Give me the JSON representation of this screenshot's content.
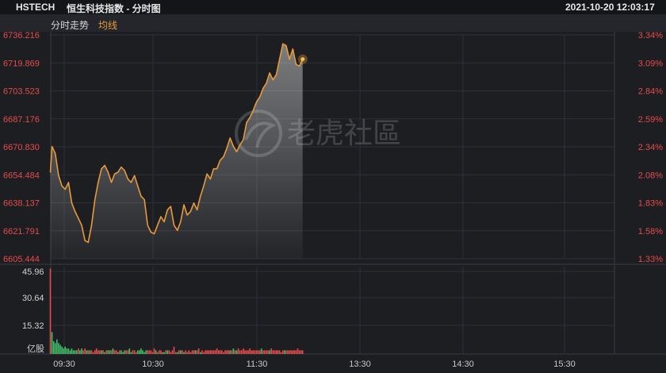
{
  "header": {
    "symbol": "HSTECH",
    "name": "恒生科技指数 - 分时图",
    "datetime": "2021-10-20 12:03:17"
  },
  "tabs": [
    {
      "label": "分时走势",
      "color": "#d8d8d8"
    },
    {
      "label": "均线",
      "color": "#e69a3c"
    }
  ],
  "watermark": "老虎社區",
  "colors": {
    "price_line": "#e69a3c",
    "up": "#e64b4b",
    "down": "#3fbf6a",
    "grid": "#2e3036"
  },
  "chart_data": [
    {
      "type": "line",
      "title": "",
      "xlabel": "",
      "ylabel": "",
      "x_ticks": [
        "09:30",
        "10:30",
        "11:30",
        "13:30",
        "14:30",
        "15:30"
      ],
      "y_ticks_left": [
        "6736.216",
        "6719.869",
        "6703.523",
        "6687.176",
        "6670.830",
        "6654.484",
        "6638.137",
        "6621.791",
        "6605.444"
      ],
      "y_ticks_right": [
        "3.34%",
        "3.09%",
        "2.84%",
        "2.59%",
        "2.34%",
        "2.08%",
        "1.83%",
        "1.58%",
        "1.33%"
      ],
      "ylim": [
        6605.444,
        6736.216
      ],
      "grid": true,
      "series": [
        {
          "x": [
            0,
            1,
            3,
            5,
            7,
            9,
            11,
            13,
            15,
            17,
            19,
            21,
            23,
            25,
            27,
            29,
            31,
            33,
            35,
            37,
            39,
            41,
            43,
            45,
            47,
            49,
            51,
            53,
            55,
            57,
            59,
            61,
            63,
            65,
            67,
            69,
            71,
            73,
            75,
            77,
            79,
            81,
            83,
            85,
            87,
            89,
            91,
            93,
            95,
            97,
            99,
            101,
            103,
            105,
            107,
            109,
            111,
            113,
            115,
            117,
            119,
            121,
            123,
            125,
            127,
            129,
            131,
            133,
            135,
            137,
            139,
            141,
            143,
            145,
            147,
            149,
            151,
            153
          ],
          "values": [
            6656,
            6671,
            6667,
            6654,
            6648,
            6646,
            6650,
            6638,
            6633,
            6629,
            6625,
            6616,
            6615,
            6625,
            6640,
            6650,
            6658,
            6660,
            6656,
            6650,
            6655,
            6656,
            6659,
            6657,
            6652,
            6650,
            6654,
            6648,
            6642,
            6640,
            6625,
            6621,
            6620,
            6625,
            6630,
            6627,
            6634,
            6636,
            6625,
            6622,
            6627,
            6637,
            6631,
            6633,
            6638,
            6634,
            6642,
            6648,
            6655,
            6652,
            6658,
            6658,
            6663,
            6665,
            6670,
            6676,
            6671,
            6668,
            6672,
            6675,
            6685,
            6688,
            6692,
            6697,
            6700,
            6705,
            6708,
            6714,
            6710,
            6713,
            6722,
            6731,
            6730,
            6722,
            6728,
            6719,
            6718,
            6722
          ]
        }
      ]
    },
    {
      "type": "bar",
      "title": "",
      "ylabel": "亿股",
      "y_ticks": [
        "45.96",
        "30.64",
        "15.32"
      ],
      "ylim": [
        0,
        48
      ],
      "grid": true,
      "x": [
        0,
        1,
        2,
        3,
        4,
        5,
        6,
        7,
        8,
        9,
        10,
        11,
        12,
        13,
        14,
        15,
        16,
        17,
        18,
        19,
        20,
        21,
        22,
        23,
        24,
        25,
        26,
        27,
        28,
        29,
        30,
        31,
        32,
        33,
        34,
        35,
        36,
        37,
        38,
        39,
        40,
        41,
        42,
        43,
        44,
        45,
        46,
        47,
        48,
        49,
        50,
        51,
        52,
        53,
        54,
        55,
        56,
        57,
        58,
        59,
        60,
        61,
        62,
        63,
        64,
        65,
        66,
        67,
        68,
        69,
        70,
        71,
        72,
        73,
        74,
        75,
        76,
        77,
        78,
        79,
        80,
        81,
        82,
        83,
        84,
        85,
        86,
        87,
        88,
        89,
        90,
        91,
        92,
        93,
        94,
        95,
        96,
        97,
        98,
        99,
        100,
        101,
        102,
        103,
        104,
        105,
        106,
        107,
        108,
        109,
        110,
        111,
        112,
        113,
        114,
        115,
        116,
        117,
        118,
        119,
        120,
        121,
        122,
        123,
        124,
        125,
        126,
        127,
        128,
        129,
        130,
        131,
        132,
        133,
        134,
        135,
        136,
        137,
        138,
        139,
        140,
        141,
        142,
        143,
        144,
        145,
        146,
        147,
        148,
        149,
        150,
        151,
        152,
        153
      ],
      "values": [
        47,
        12,
        7,
        6,
        8,
        6,
        5,
        4,
        3,
        4,
        3,
        3,
        2,
        3,
        2,
        2,
        2,
        3,
        2,
        3,
        2,
        3,
        2,
        2,
        2,
        2,
        1,
        2,
        3,
        2,
        2,
        2,
        2,
        1,
        2,
        2,
        2,
        2,
        3,
        2,
        2,
        1,
        2,
        2,
        1,
        2,
        2,
        2,
        3,
        1,
        2,
        2,
        1,
        2,
        2,
        3,
        2,
        1,
        2,
        2,
        2,
        2,
        1,
        3,
        2,
        1,
        2,
        2,
        1,
        1,
        2,
        2,
        2,
        1,
        2,
        4,
        1,
        1,
        2,
        2,
        2,
        1,
        2,
        1,
        2,
        1,
        2,
        2,
        2,
        2,
        3,
        1,
        2,
        1,
        2,
        2,
        2,
        2,
        2,
        2,
        2,
        3,
        2,
        2,
        2,
        1,
        2,
        2,
        2,
        2,
        2,
        3,
        2,
        2,
        3,
        2,
        2,
        3,
        2,
        2,
        2,
        3,
        2,
        2,
        2,
        2,
        2,
        2,
        3,
        2,
        2,
        2,
        2,
        2,
        3,
        2,
        2,
        2,
        2,
        2,
        1,
        2,
        2,
        2,
        2,
        2,
        2,
        2,
        2,
        2,
        3,
        2,
        2,
        2
      ],
      "directions": [
        1,
        -1,
        -1,
        -1,
        -1,
        -1,
        -1,
        -1,
        -1,
        -1,
        -1,
        -1,
        -1,
        -1,
        -1,
        -1,
        -1,
        1,
        -1,
        -1,
        1,
        1,
        -1,
        1,
        -1,
        1,
        1,
        1,
        1,
        1,
        1,
        -1,
        1,
        -1,
        1,
        -1,
        -1,
        1,
        -1,
        1,
        1,
        -1,
        1,
        -1,
        -1,
        -1,
        1,
        1,
        -1,
        -1,
        1,
        1,
        1,
        -1,
        -1,
        -1,
        -1,
        -1,
        -1,
        1,
        1,
        1,
        1,
        1,
        -1,
        1,
        1,
        1,
        -1,
        -1,
        1,
        -1,
        1,
        1,
        1,
        1,
        1,
        -1,
        1,
        -1,
        1,
        -1,
        1,
        1,
        1,
        1,
        1,
        1,
        -1,
        1,
        1,
        -1,
        1,
        1,
        1,
        1,
        1,
        1,
        1,
        1,
        1,
        1,
        1,
        1,
        1,
        1,
        1,
        1,
        1,
        -1,
        1,
        -1,
        1,
        -1,
        1,
        1,
        1,
        1,
        1,
        1,
        1,
        1,
        1,
        1,
        1,
        1,
        1,
        1,
        -1,
        1,
        1,
        1,
        1,
        -1,
        1,
        1,
        1,
        1,
        1,
        1,
        1,
        1,
        -1,
        1,
        1,
        1,
        1,
        1,
        1,
        1,
        1,
        1,
        1,
        1
      ]
    }
  ]
}
